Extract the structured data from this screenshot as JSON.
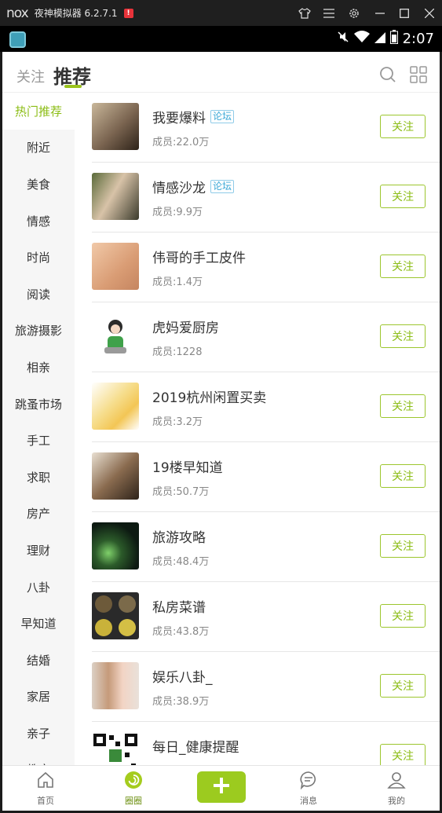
{
  "emulator": {
    "logo": "nox",
    "title": "夜神模拟器 6.2.7.1",
    "warning": "!"
  },
  "status": {
    "time": "2:07"
  },
  "header": {
    "tab_follow": "关注",
    "tab_recommend": "推荐"
  },
  "sidebar": {
    "items": [
      {
        "label": "热门推荐"
      },
      {
        "label": "附近"
      },
      {
        "label": "美食"
      },
      {
        "label": "情感"
      },
      {
        "label": "时尚"
      },
      {
        "label": "阅读"
      },
      {
        "label": "旅游摄影"
      },
      {
        "label": "相亲"
      },
      {
        "label": "跳蚤市场"
      },
      {
        "label": "手工"
      },
      {
        "label": "求职"
      },
      {
        "label": "房产"
      },
      {
        "label": "理财"
      },
      {
        "label": "八卦"
      },
      {
        "label": "早知道"
      },
      {
        "label": "结婚"
      },
      {
        "label": "家居"
      },
      {
        "label": "亲子"
      },
      {
        "label": "教育"
      }
    ]
  },
  "groups": [
    {
      "name": "我要爆料",
      "tag": "论坛",
      "members": "成员:22.0万",
      "follow": "关注"
    },
    {
      "name": "情感沙龙",
      "tag": "论坛",
      "members": "成员:9.9万",
      "follow": "关注"
    },
    {
      "name": "伟哥的手工皮件",
      "tag": "",
      "members": "成员:1.4万",
      "follow": "关注"
    },
    {
      "name": "虎妈爱厨房",
      "tag": "",
      "members": "成员:1228",
      "follow": "关注"
    },
    {
      "name": "2019杭州闲置买卖",
      "tag": "",
      "members": "成员:3.2万",
      "follow": "关注"
    },
    {
      "name": "19楼早知道",
      "tag": "",
      "members": "成员:50.7万",
      "follow": "关注"
    },
    {
      "name": "旅游攻略",
      "tag": "",
      "members": "成员:48.4万",
      "follow": "关注"
    },
    {
      "name": "私房菜谱",
      "tag": "",
      "members": "成员:43.8万",
      "follow": "关注"
    },
    {
      "name": "娱乐八卦_",
      "tag": "",
      "members": "成员:38.9万",
      "follow": "关注"
    },
    {
      "name": "每日_健康提醒",
      "tag": "",
      "members": "",
      "follow": "关注"
    }
  ],
  "bottom_nav": {
    "home": "首页",
    "circle": "圈圈",
    "messages": "消息",
    "mine": "我的"
  },
  "colors": {
    "accent": "#8cbd16",
    "tag_blue": "#39a7d6"
  }
}
